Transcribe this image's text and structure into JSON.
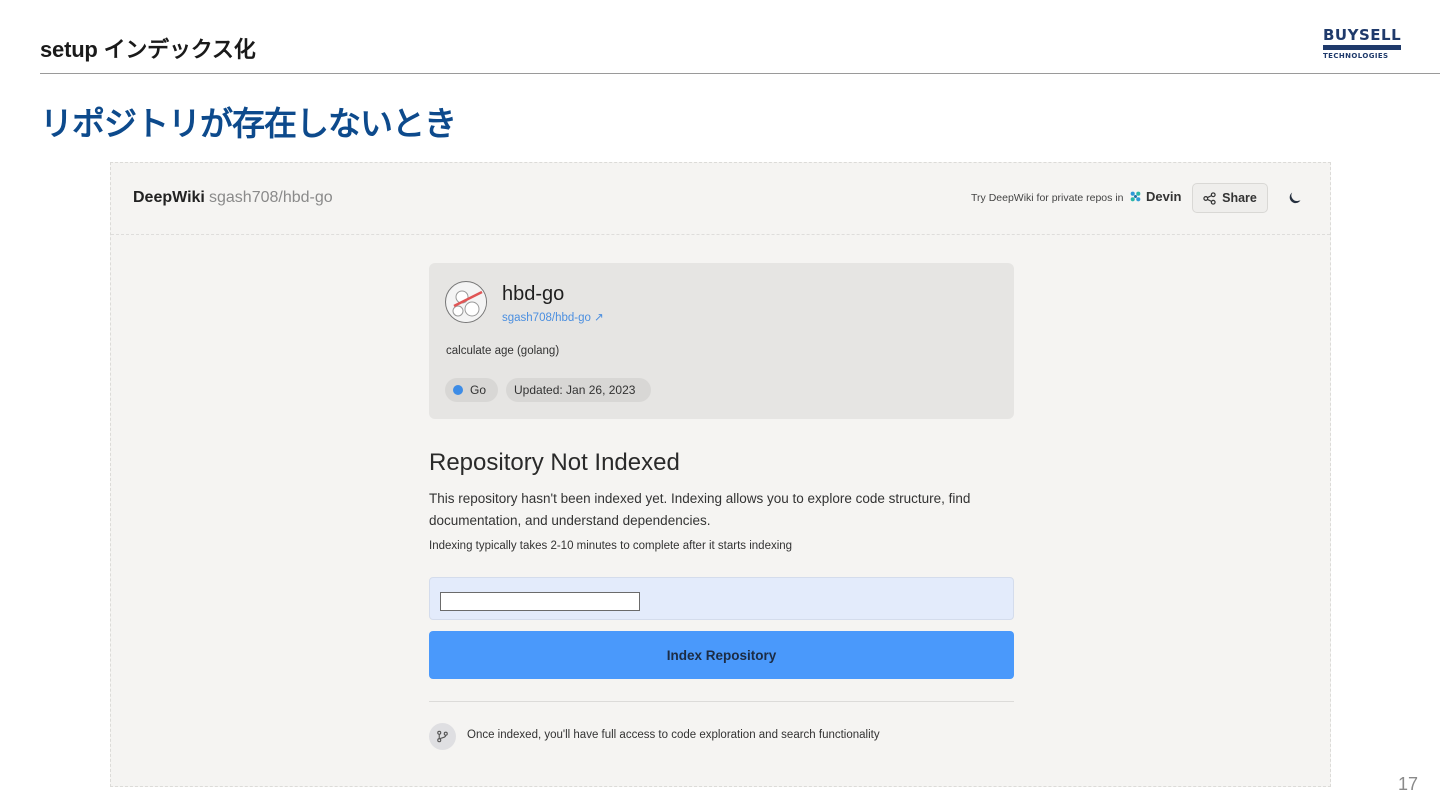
{
  "slide": {
    "header": "setup インデックス化",
    "title": "リポジトリが存在しないとき",
    "page_number": "17",
    "logo": {
      "top": "BUYSELL",
      "bottom": "TECHNOLOGIES",
      "color": "#1f3a6b"
    }
  },
  "app": {
    "brand": "DeepWiki",
    "repo_path": "sgash708/hbd-go",
    "try_text": "Try DeepWiki for private repos in",
    "devin_label": "Devin",
    "share_label": "Share",
    "theme_icon": "moon-icon"
  },
  "repo_card": {
    "name": "hbd-go",
    "link": "sgash708/hbd-go ↗",
    "description": "calculate age (golang)",
    "language": "Go",
    "language_color": "#3d8ce6",
    "updated": "Updated: Jan 26, 2023"
  },
  "not_indexed": {
    "title": "Repository Not Indexed",
    "body": "This repository hasn't been indexed yet. Indexing allows you to explore code structure, find documentation, and understand dependencies.",
    "note": "Indexing typically takes 2-10 minutes to complete after it starts indexing",
    "input_value": "",
    "button_label": "Index Repository",
    "button_color": "#4a99fb",
    "footer": "Once indexed, you'll have full access to code exploration and search functionality"
  }
}
